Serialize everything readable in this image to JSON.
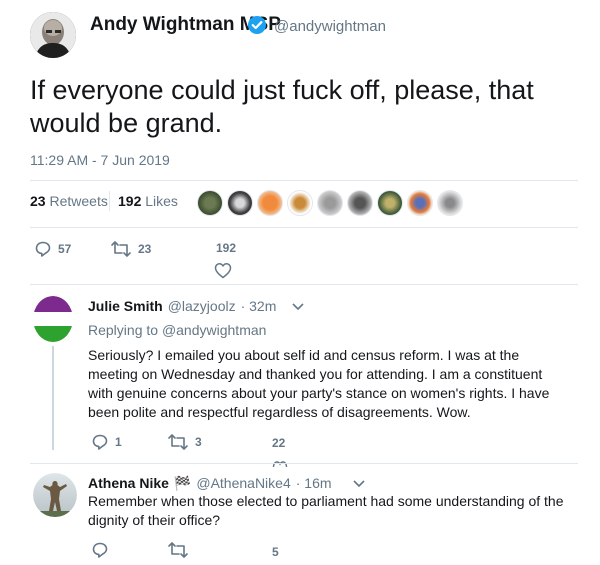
{
  "main_tweet": {
    "author_name": "Andy Wightman MSP",
    "author_handle": "@andywightman",
    "text": "If everyone could just fuck off, please, that would be grand.",
    "timestamp": "11:29 AM - 7 Jun 2019",
    "retweets_count": "23",
    "retweets_label": "Retweets",
    "likes_count": "192",
    "likes_label": "Likes",
    "actions": {
      "replies": "57",
      "retweets": "23",
      "likes": "192"
    }
  },
  "replies": [
    {
      "author_name": "Julie Smith",
      "author_handle": "@lazyjoolz",
      "time": "· 32m",
      "replying_prefix": "Replying to",
      "replying_handle": "@andywightman",
      "text": "Seriously? I emailed you about self id and census reform. I was at the meeting on Wednesday and thanked you for attending. I am a constituent with genuine concerns about your party's stance on women's rights. I have been polite and respectful regardless of disagreements. Wow.",
      "actions": {
        "replies": "1",
        "retweets": "3",
        "likes": "22"
      }
    },
    {
      "author_name": "Athena Nike",
      "author_flag": "🏁",
      "author_handle": "@AthenaNike4",
      "time": "· 16m",
      "text": "Remember when those elected to parliament had some understanding of the dignity of their office?",
      "actions": {
        "likes": "5"
      }
    }
  ],
  "colors": {
    "verified_blue": "#1da1f2",
    "muted": "#657786",
    "text": "#14171a",
    "divider": "#e1e8ed",
    "suffragette_purple": "#7d2a8f",
    "suffragette_green": "#2ea22e"
  }
}
